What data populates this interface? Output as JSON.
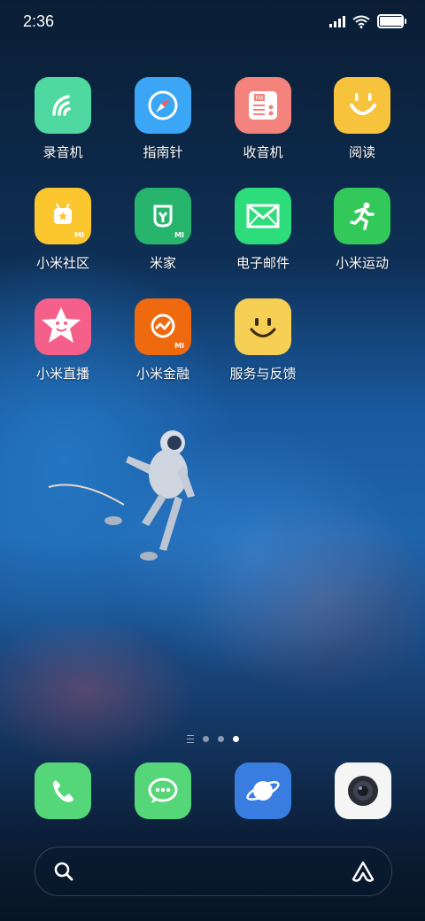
{
  "status_bar": {
    "time": "2:36",
    "battery_level": 1.0
  },
  "apps": [
    {
      "label": "录音机",
      "icon": "recorder-icon",
      "color": "#4fd9a0"
    },
    {
      "label": "指南针",
      "icon": "compass-icon",
      "color": "#3aa6f5"
    },
    {
      "label": "收音机",
      "icon": "radio-icon",
      "color": "#f4837d"
    },
    {
      "label": "阅读",
      "icon": "reader-icon",
      "color": "#f7c33c"
    },
    {
      "label": "小米社区",
      "icon": "community-icon",
      "color": "#fbc62e"
    },
    {
      "label": "米家",
      "icon": "mijia-icon",
      "color": "#27b56d"
    },
    {
      "label": "电子邮件",
      "icon": "mail-icon",
      "color": "#2ddc7a"
    },
    {
      "label": "小米运动",
      "icon": "run-icon",
      "color": "#33c95a"
    },
    {
      "label": "小米直播",
      "icon": "live-icon",
      "color": "#f4608a"
    },
    {
      "label": "小米金融",
      "icon": "finance-icon",
      "color": "#ef6a0e"
    },
    {
      "label": "服务与反馈",
      "icon": "feedback-icon",
      "color": "#f6cf55"
    }
  ],
  "page_indicator": {
    "pages": 3,
    "active_page": 3
  },
  "dock": [
    {
      "name": "phone-icon",
      "color": "#55d678"
    },
    {
      "name": "message-icon",
      "color": "#55d678"
    },
    {
      "name": "browser-icon",
      "color": "#3a7de0"
    },
    {
      "name": "camera-icon",
      "color": "#f5f5f5"
    }
  ],
  "mi_badge": "MI"
}
